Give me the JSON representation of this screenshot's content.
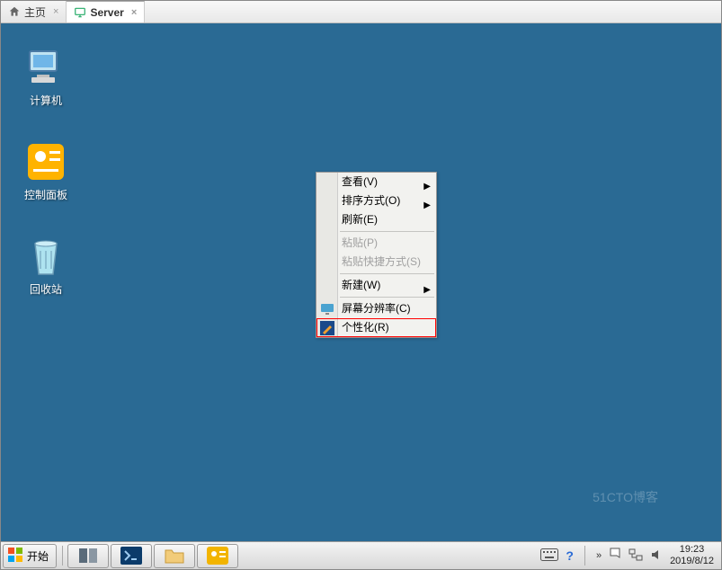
{
  "tabs": [
    {
      "label": "主页",
      "icon": "home-icon"
    },
    {
      "label": "Server",
      "icon": "monitor-icon"
    }
  ],
  "desktop_icons": [
    {
      "label": "计算机",
      "name": "computer-icon"
    },
    {
      "label": "控制面板",
      "name": "control-panel-icon"
    },
    {
      "label": "回收站",
      "name": "recycle-bin-icon"
    }
  ],
  "context_menu": [
    {
      "label": "查看(V)",
      "type": "submenu"
    },
    {
      "label": "排序方式(O)",
      "type": "submenu"
    },
    {
      "label": "刷新(E)",
      "type": "item"
    },
    {
      "type": "sep"
    },
    {
      "label": "粘贴(P)",
      "type": "disabled"
    },
    {
      "label": "粘贴快捷方式(S)",
      "type": "disabled"
    },
    {
      "type": "sep"
    },
    {
      "label": "新建(W)",
      "type": "submenu"
    },
    {
      "type": "sep"
    },
    {
      "label": "屏幕分辨率(C)",
      "type": "item",
      "icon": true
    },
    {
      "label": "个性化(R)",
      "type": "highlighted",
      "icon": true
    }
  ],
  "start_label": "开始",
  "taskbar_buttons": [
    {
      "name": "server-manager",
      "color": "#3a7fbf"
    },
    {
      "name": "powershell",
      "color": "#0b3b6a"
    },
    {
      "name": "explorer",
      "color": "#e8b84a"
    },
    {
      "name": "control-panel",
      "color": "#f2b400"
    }
  ],
  "tray": {
    "time": "19:23",
    "date": "2019/8/12"
  },
  "watermark": "51CTO博客"
}
